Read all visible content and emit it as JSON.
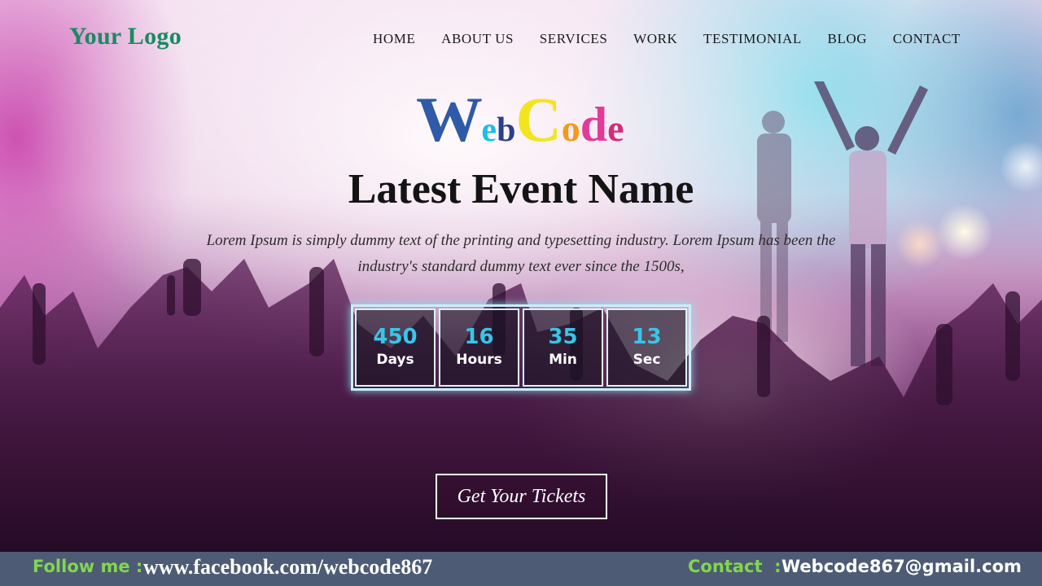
{
  "header": {
    "logo": "Your Logo",
    "nav": [
      "HOME",
      "ABOUT US",
      "SERVICES",
      "WORK",
      "TESTIMONIAL",
      "BLOG",
      "CONTACT"
    ]
  },
  "hero": {
    "brand": {
      "w": "W",
      "e": "e",
      "b": "b",
      "c": "C",
      "o": "o",
      "d": "d",
      "e2": "e"
    },
    "title": "Latest Event Name",
    "description": "Lorem Ipsum is simply dummy text of the printing and typesetting industry. Lorem Ipsum has been the industry's standard dummy text ever since the 1500s,",
    "countdown": [
      {
        "value": "450",
        "unit": "Days"
      },
      {
        "value": "16",
        "unit": "Hours"
      },
      {
        "value": "35",
        "unit": "Min"
      },
      {
        "value": "13",
        "unit": "Sec"
      }
    ],
    "cta": "Get Your Tickets"
  },
  "footer": {
    "follow_label": "Follow me :",
    "facebook": "www.facebook.com/webcode867",
    "contact_label": "Contact  :",
    "email": "Webcode867@gmail.com"
  },
  "colors": {
    "logo": "#1a8a62",
    "countdown_number": "#37c6e8",
    "footer_bg": "#4d5c74",
    "footer_label": "#82d64f"
  }
}
